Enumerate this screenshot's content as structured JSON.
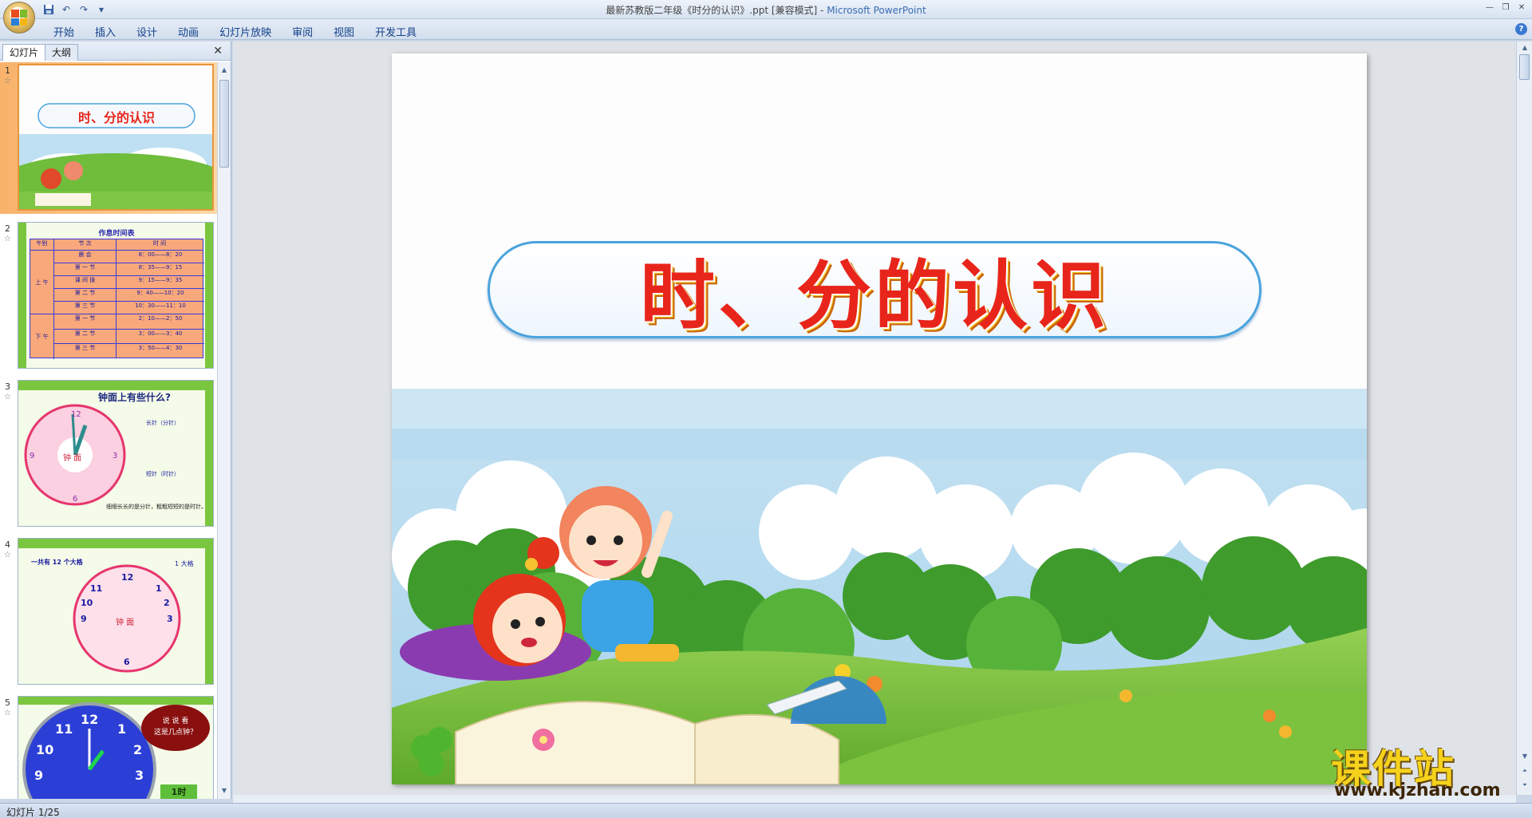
{
  "window": {
    "title": "最新苏教版二年级《时分的认识》.ppt [兼容模式]",
    "app_name": "Microsoft PowerPoint",
    "separator": " - "
  },
  "ribbon": {
    "tabs": [
      "开始",
      "插入",
      "设计",
      "动画",
      "幻灯片放映",
      "审阅",
      "视图",
      "开发工具"
    ]
  },
  "left_pane": {
    "tab_slides": "幻灯片",
    "tab_outline": "大纲",
    "close_symbol": "✕"
  },
  "thumbnails": [
    {
      "num": "1",
      "title": "时、分的认识"
    },
    {
      "num": "2",
      "title": "作息时间表",
      "headers": [
        "午别",
        "节 次",
        "时    间"
      ],
      "am_label": "上 午",
      "pm_label": "下 午",
      "rows": [
        [
          "晨 会",
          "8：00——8：20"
        ],
        [
          "第 一 节",
          "8：35——9：15"
        ],
        [
          "课 间 操",
          "9：15——9：35"
        ],
        [
          "第 二 节",
          "9：40——10：20"
        ],
        [
          "第 三 节",
          "10：30——11：10"
        ],
        [
          "第 一 节",
          "2：10——2：50"
        ],
        [
          "第 二 节",
          "3：00——3：40"
        ],
        [
          "第 三 节",
          "3：50——4：30"
        ]
      ]
    },
    {
      "num": "3",
      "title": "钟面上有些什么?",
      "face_label": "钟 面",
      "long_hand": "长针（分针）",
      "short_hand": "短针（时针）",
      "note": "细细长长的是分针，粗粗短短的是时针。"
    },
    {
      "num": "4",
      "caption": "一共有 12 个大格",
      "hint": "1 大格",
      "face_label": "钟 面"
    },
    {
      "num": "5",
      "bubble_1": "说 说 看",
      "bubble_2": "这是几点钟？",
      "answer": "1时"
    }
  ],
  "slide": {
    "title": "时、分的认识"
  },
  "status": {
    "text": "幻灯片 1/25"
  },
  "watermark": {
    "cn": "课件站",
    "url": "www.kjzhan.com"
  },
  "colors": {
    "title_red": "#e8251b",
    "ribbon_text": "#15428b",
    "selection_orange": "#f8b26a"
  }
}
